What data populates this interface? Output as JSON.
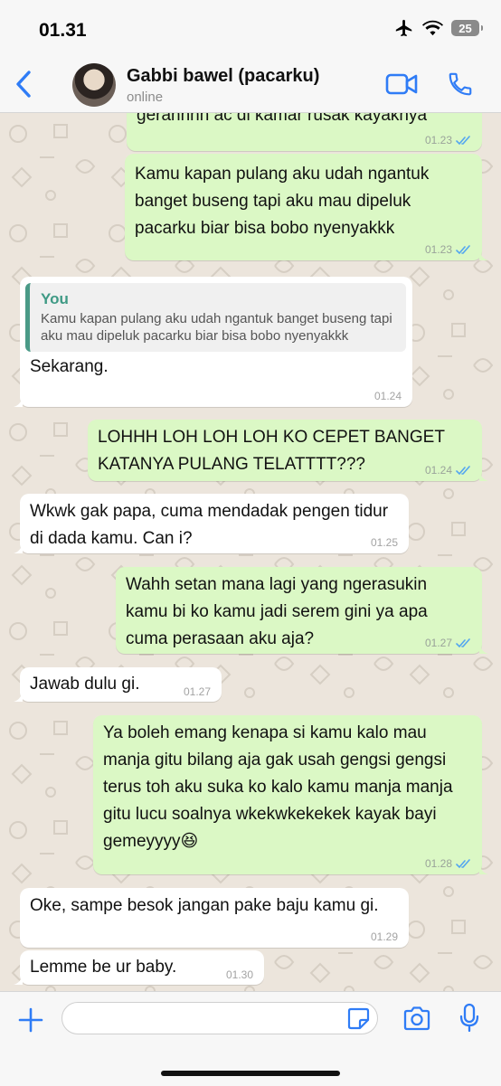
{
  "status_bar": {
    "time": "01.31",
    "battery": "25"
  },
  "header": {
    "contact_name": "Gabbi bawel (pacarku)",
    "status": "online"
  },
  "messages": [
    {
      "type": "outgoing",
      "text": "gerahhhh ac di kamar rusak kayaknya",
      "time": "01.23",
      "read": true
    },
    {
      "type": "outgoing",
      "text": "Kamu kapan pulang aku udah ngantuk banget buseng tapi aku mau dipeluk pacarku biar bisa bobo nyenyakkk",
      "time": "01.23",
      "read": true
    },
    {
      "type": "incoming",
      "quote_author": "You",
      "quote_text": "Kamu kapan pulang aku udah ngantuk banget buseng tapi aku mau dipeluk pacarku biar bisa bobo nyenyakkk",
      "text": "Sekarang.",
      "time": "01.24"
    },
    {
      "type": "outgoing",
      "text": "LOHHH LOH LOH LOH KO CEPET BANGET KATANYA PULANG TELATTTT???",
      "time": "01.24",
      "read": true
    },
    {
      "type": "incoming",
      "text": "Wkwk gak papa, cuma mendadak pengen tidur di dada kamu. Can i?",
      "time": "01.25"
    },
    {
      "type": "outgoing",
      "text": "Wahh setan mana lagi yang ngerasukin kamu bi ko kamu jadi serem gini ya apa cuma perasaan aku aja?",
      "time": "01.27",
      "read": true
    },
    {
      "type": "incoming",
      "text": "Jawab dulu gi.",
      "time": "01.27"
    },
    {
      "type": "outgoing",
      "text": "Ya boleh emang kenapa si kamu kalo mau manja gitu bilang aja gak usah gengsi gengsi terus toh aku suka ko kalo kamu manja manja gitu lucu soalnya wkekwkekekek kayak bayi gemeyyyy😆",
      "time": "01.28",
      "read": true
    },
    {
      "type": "incoming",
      "text": "Oke, sampe besok jangan pake baju kamu gi.",
      "time": "01.29"
    },
    {
      "type": "incoming",
      "text": "Lemme be ur baby.",
      "time": "01.30"
    }
  ],
  "input": {
    "placeholder": "",
    "value": ""
  },
  "colors": {
    "outgoing_bubble": "#dbf8c5",
    "incoming_bubble": "#ffffff",
    "accent_blue": "#2f7cf6",
    "read_ticks": "#53a6f0",
    "quote_accent": "#4a9a87",
    "chat_background": "#ece5dc"
  },
  "icons": [
    "back-chevron-icon",
    "video-call-icon",
    "phone-icon",
    "airplane-icon",
    "wifi-icon",
    "battery-icon",
    "plus-icon",
    "sticker-icon",
    "camera-icon",
    "microphone-icon",
    "read-ticks-icon"
  ]
}
